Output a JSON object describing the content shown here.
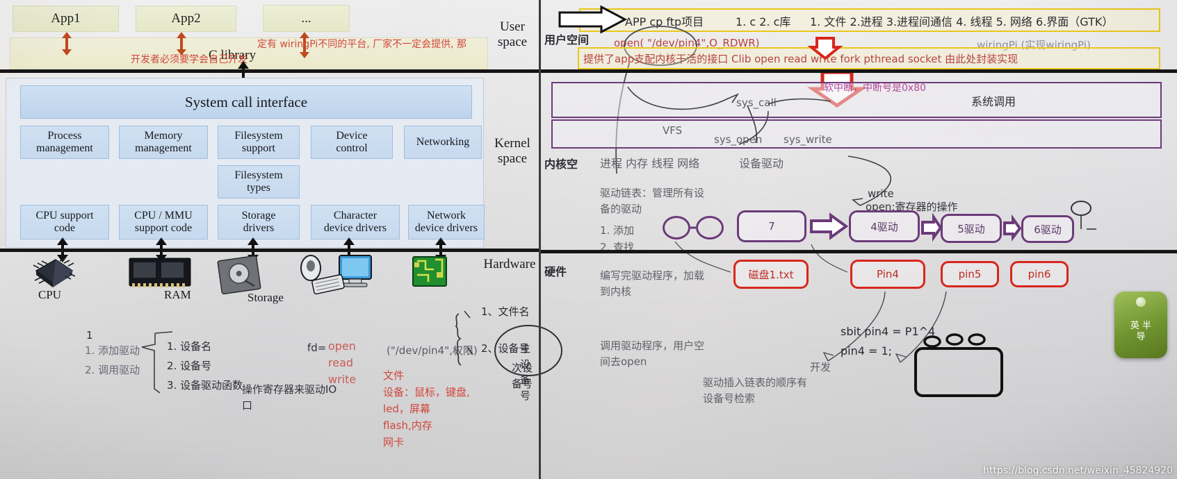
{
  "left": {
    "user_space": {
      "apps": [
        "App1",
        "App2",
        "..."
      ],
      "c_library": "C library",
      "notes": [
        "定有  wiringPi不同的平台, 厂家不一定会提供, 那",
        "开发者必须要学会自己开发"
      ]
    },
    "kernel_space": {
      "syscall_interface": "System call interface",
      "row1": [
        "Process\nmanagement",
        "Memory\nmanagement",
        "Filesystem\nsupport",
        "Device\ncontrol",
        "Networking"
      ],
      "row2": [
        "Filesystem\ntypes"
      ],
      "row3": [
        "CPU support\ncode",
        "CPU / MMU\nsupport code",
        "Storage\ndrivers",
        "Character\ndevice drivers",
        "Network\ndevice drivers"
      ]
    },
    "hardware": {
      "labels": [
        "CPU",
        "RAM",
        "Storage"
      ],
      "icons": [
        "cpu-chip-icon",
        "ram-module-icon",
        "hard-disk-icon",
        "mouse-keyboard-monitor-icon",
        "network-card-icon"
      ]
    },
    "side_labels": {
      "user": "User\nspace",
      "kernel": "Kernel\nspace",
      "hardware": "Hardware"
    },
    "bottom_notes": {
      "col1": [
        "1",
        "1. 添加驱动",
        "2. 调用驱动"
      ],
      "col2": [
        "1. 设备名",
        "2. 设备号",
        "3. 设备驱动函数"
      ],
      "fd_label": "fd=",
      "fd_calls": [
        "open",
        "read",
        "write"
      ],
      "fd_args": "(\"/dev/pin4\",权限)",
      "register_note": "操作寄存器来驱动IO\n口",
      "red_list": [
        "文件",
        "设备：鼠标，键盘,",
        "led，屏幕",
        "flash,内存",
        "网卡"
      ],
      "brace_items": [
        "1、文件名",
        "2、设备号"
      ],
      "dev_numbers": [
        "主设备号",
        "次设备号"
      ]
    }
  },
  "right": {
    "side_labels": {
      "user": "用户空间",
      "kernel": "内核空",
      "hardware": "硬件"
    },
    "app_row": {
      "app": "APP  cp ftp项目",
      "libs": "1. c  2. c库",
      "topics": "1. 文件 2.进程 3.进程间通信 4. 线程 5. 网络  6.界面（GTK）"
    },
    "open_call": "open( \"/dev/pin4\",O_RDWR)",
    "wiringpi": "wiringPi  (实现wiringPi)",
    "clib_row": "提供了app支配内核干活的接口  Clib  open read write fork pthread socket 由此处封装实现",
    "interrupt_note": "软中断，中断号是0x80",
    "syscall_label": "系统调用",
    "sys_call": "sys_call",
    "vfs": "VFS",
    "sys_open": "sys_open",
    "sys_write": "sys_write",
    "kernel_items": "进程 内存 线程 网络",
    "device_driver": "设备驱动",
    "driver_list_note": "驱动链表：管理所有设\n备的驱动",
    "driver_steps": [
      "1. 添加",
      "2. 查找"
    ],
    "driver_boxes": [
      "7",
      "4驱动",
      "5驱动",
      "6驱动"
    ],
    "write_note": "write",
    "open_reg_note": "open:寄存器的操作",
    "hw_notes": [
      "编写完驱动程序，加载\n到内核",
      "调用驱动程序，用户空\n间去open"
    ],
    "device_files": [
      "磁盘1.txt",
      "Pin4",
      "pin5",
      "pin6"
    ],
    "code_lines": [
      "sbit pin4 = P1^4",
      "pin4 = 1;"
    ],
    "develop_label": "开发",
    "insert_note": "驱动插入链表的顺序有\n设备号检索",
    "chip_label": "英 半\n导"
  },
  "watermark": "https://blog.csdn.net/weixin_45824920",
  "colors": {
    "accent_yellow": "#e8c71d",
    "accent_red": "#d8261d",
    "accent_purple": "#6b3b7a",
    "kernel_blue": "#cfe0f2",
    "app_olive": "#eceed6"
  }
}
